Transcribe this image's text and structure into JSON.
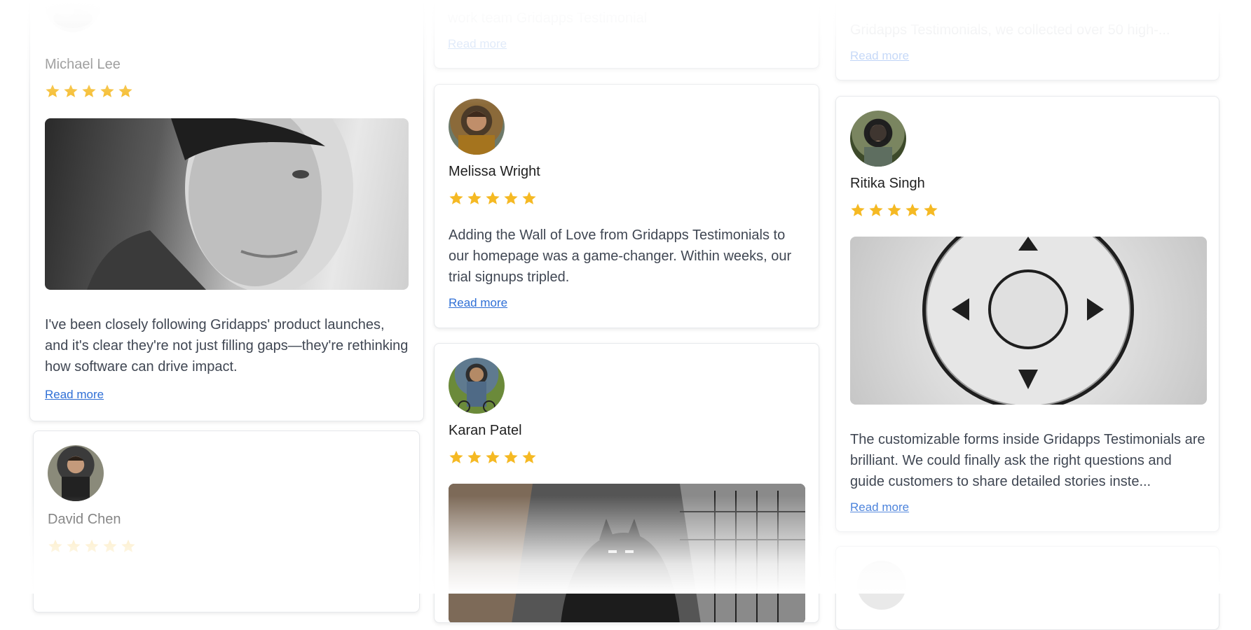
{
  "colors": {
    "star": "#f5b923",
    "link": "#2f6fd6",
    "text": "#404753"
  },
  "cards": {
    "michael": {
      "name": "Michael Lee",
      "rating": 5,
      "avatar_icon": "avatar-photo",
      "media_icon": "portrait-photo",
      "text": "I've been closely following Gridapps' product launches, and it's clear they're not just filling gaps—they're rethinking how software can drive impact.",
      "read_more": "Read more"
    },
    "david": {
      "name": "David Chen",
      "rating": 5,
      "avatar_icon": "avatar-photo"
    },
    "top_mid": {
      "text": "work team Gridapps Testimonial",
      "read_more": "Read more"
    },
    "melissa": {
      "name": "Melissa Wright",
      "rating": 5,
      "avatar_icon": "avatar-photo",
      "text": "Adding the Wall of Love from Gridapps Testimonials to our homepage was a game-changer. Within weeks, our trial signups tripled.",
      "read_more": "Read more"
    },
    "karan": {
      "name": "Karan Patel",
      "rating": 5,
      "avatar_icon": "avatar-photo",
      "media_icon": "comic-illustration"
    },
    "top_right": {
      "text": "Gridapps Testimonials, we collected over 50 high-...",
      "read_more": "Read more"
    },
    "ritika": {
      "name": "Ritika Singh",
      "rating": 5,
      "avatar_icon": "avatar-photo",
      "media_icon": "dpad-controller-image",
      "text": "The customizable forms inside Gridapps Testimonials are brilliant. We could finally ask the right questions and guide customers to share detailed stories inste...",
      "read_more": "Read more"
    }
  }
}
